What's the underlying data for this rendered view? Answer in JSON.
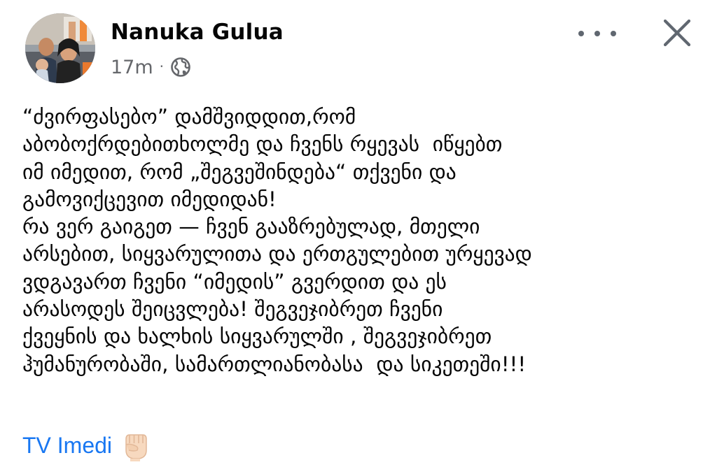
{
  "post": {
    "author": "Nanuka Gulua",
    "time": "17m",
    "separator": "·",
    "privacy_icon": "globe-icon",
    "menu_icon": "more-horizontal-icon",
    "close_icon": "close-icon",
    "body_lines": [
      "“ძვირფასებო” დამშვიდდით,რომ",
      "აბობოქრდებითხოლმე და ჩვენს რყევას  იწყებთ",
      "იმ იმედით, რომ „შეგვეშინდება“ თქვენი და",
      "გამოვიქცევით იმედიდან!",
      "რა ვერ გაიგეთ — ჩვენ გააზრებულად, მთელი",
      "არსებით, სიყვარულითა და ერთგულებით ურყევად",
      "ვდგავართ ჩვენი “იმედის” გვერდით და ეს",
      "არასოდეს შეიცვლება! შეგვეჯიბრეთ ჩვენი",
      "ქვეყნის და ხალხის სიყვარულში , შეგვეჯიბრეთ",
      "ჰუმანურობაში, სამართლიანობასა  და სიკეთეში!!!"
    ],
    "tag": "TV Imedi",
    "tag_emoji_icon": "raised-fist-icon"
  },
  "colors": {
    "text": "#050505",
    "secondary_text": "#65676b",
    "link": "#1877f2",
    "background": "#ffffff"
  }
}
